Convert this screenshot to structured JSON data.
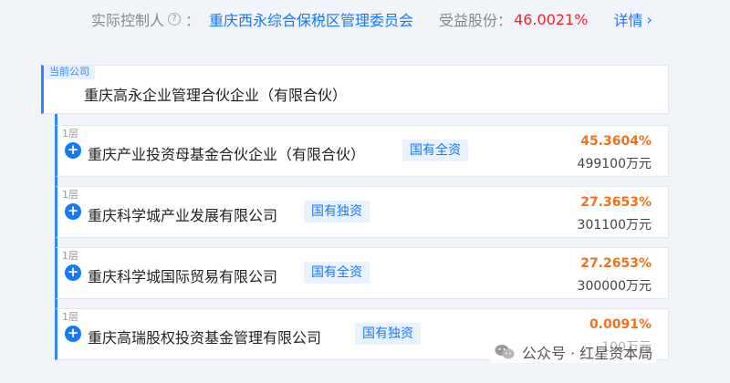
{
  "header": {
    "controller_label": "实际控制人",
    "colon": "：",
    "controller_name": "重庆西永综合保税区管理委员会",
    "benefit_label": "受益股份：",
    "benefit_ratio": "46.0021%",
    "detail_link": "详情"
  },
  "current_company": {
    "tag": "当前公司",
    "name": "重庆高永企业管理合伙企业（有限合伙）"
  },
  "holders": [
    {
      "level": "1层",
      "name": "重庆产业投资母基金合伙企业（有限合伙）",
      "badge": "国有全资",
      "percent": "45.3604%",
      "amount": "499100万元"
    },
    {
      "level": "1层",
      "name": "重庆科学城产业发展有限公司",
      "badge": "国有独资",
      "percent": "27.3653%",
      "amount": "301100万元"
    },
    {
      "level": "1层",
      "name": "重庆科学城国际贸易有限公司",
      "badge": "国有全资",
      "percent": "27.2653%",
      "amount": "300000万元"
    },
    {
      "level": "1层",
      "name": "重庆高瑞股权投资基金管理有限公司",
      "badge": "国有独资",
      "percent": "0.0091%",
      "amount": "100万元"
    }
  ],
  "watermark": {
    "text": "公众号 · 红星资本局"
  },
  "colors": {
    "accent": "#1677ff",
    "percent": "#f5701a",
    "ratio": "#f5222d"
  }
}
